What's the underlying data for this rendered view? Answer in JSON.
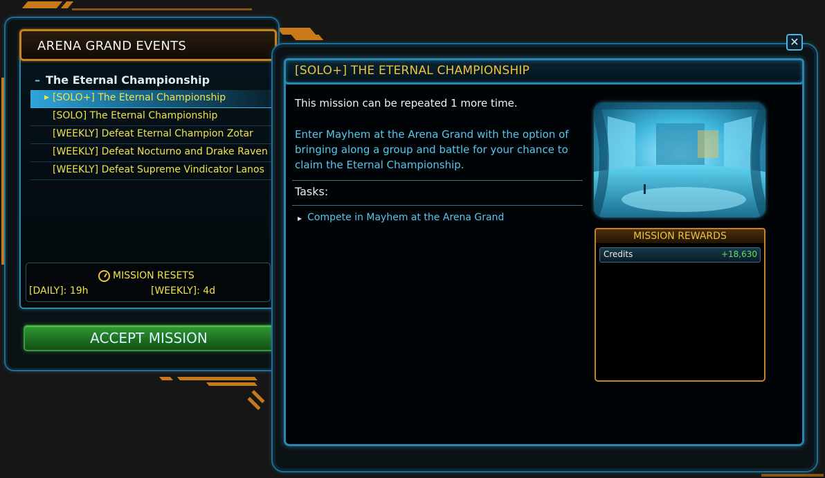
{
  "window": {
    "left_title": "ARENA GRAND EVENTS",
    "close_glyph": "✕"
  },
  "mission_list": {
    "group_title": "The Eternal Championship",
    "items": [
      {
        "label": "[SOLO+] The Eternal Championship",
        "selected": true
      },
      {
        "label": "[SOLO] The Eternal Championship",
        "selected": false
      },
      {
        "label": "[WEEKLY] Defeat Eternal Champion Zotar",
        "selected": false
      },
      {
        "label": "[WEEKLY] Defeat Nocturno and Drake Raven",
        "selected": false
      },
      {
        "label": "[WEEKLY] Defeat Supreme Vindicator Lanos",
        "selected": false
      }
    ]
  },
  "resets": {
    "title": "MISSION RESETS",
    "daily": "[DAILY]: 19h",
    "weekly": "[WEEKLY]: 4d"
  },
  "accept_button": "ACCEPT MISSION",
  "mission": {
    "title": "[SOLO+] THE ETERNAL CHAMPIONSHIP",
    "repeat_note": "This mission can be repeated 1 more time.",
    "description": "Enter Mayhem at the Arena Grand with the option of bringing along a group and battle for your chance to claim the Eternal Championship.",
    "tasks_label": "Tasks:",
    "tasks": [
      "Compete in Mayhem at the Arena Grand"
    ]
  },
  "rewards": {
    "title": "MISSION REWARDS",
    "items": [
      {
        "name": "Credits",
        "value": "+18,630"
      }
    ]
  },
  "colors": {
    "accent_orange": "#c8821f",
    "accent_blue": "#2a87b1",
    "mission_yellow": "#f0e24b",
    "title_gold": "#f0c23b",
    "text_cyan": "#56c8ec",
    "credit_green": "#5ee05e",
    "accept_green": "#2f9a31"
  }
}
